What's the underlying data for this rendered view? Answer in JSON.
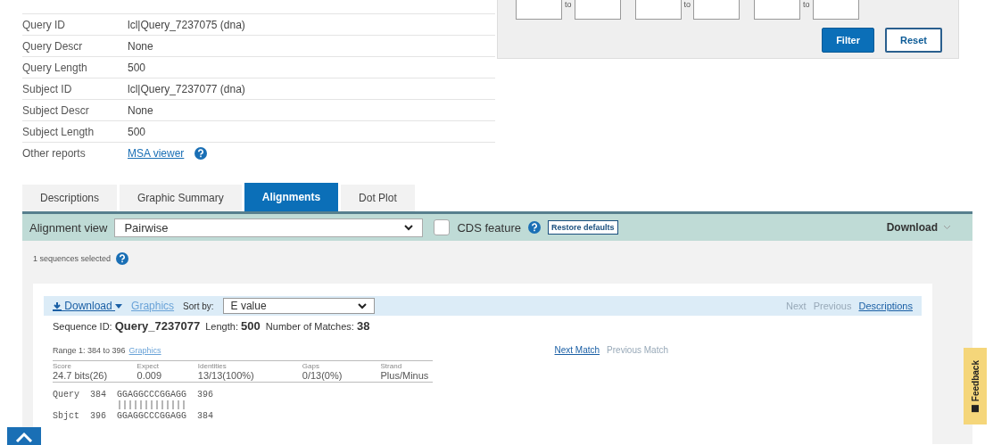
{
  "info_table": [
    {
      "label": "Query ID",
      "value": "lcl|Query_7237075 (dna)"
    },
    {
      "label": "Query Descr",
      "value": "None"
    },
    {
      "label": "Query Length",
      "value": "500"
    },
    {
      "label": "Subject ID",
      "value": "lcl|Query_7237077 (dna)"
    },
    {
      "label": "Subject Descr",
      "value": "None"
    },
    {
      "label": "Subject Length",
      "value": "500"
    },
    {
      "label": "Other reports",
      "link": "MSA viewer",
      "help": true
    }
  ],
  "filter": {
    "range_separators": [
      "to",
      "to",
      "to"
    ],
    "buttons": [
      {
        "label": "Filter",
        "kind": "primary"
      },
      {
        "label": "Reset",
        "kind": "secondary"
      }
    ]
  },
  "tabs": [
    {
      "label": "Descriptions",
      "selected": false
    },
    {
      "label": "Graphic Summary",
      "selected": false
    },
    {
      "label": "Alignments",
      "selected": true
    },
    {
      "label": "Dot Plot",
      "selected": false
    }
  ],
  "toolbar": {
    "label": "Alignment view",
    "view": "Pairwise",
    "cds_label": "CDS feature",
    "cds_checked": false,
    "restore": "Restore defaults",
    "download": "Download"
  },
  "selection_note": "1 sequences selected",
  "hit": {
    "download": "Download",
    "graphics": "Graphics",
    "sort_label": "Sort by:",
    "sort_value": "E value",
    "nav": [
      {
        "label": "Next",
        "disabled": true
      },
      {
        "label": "Previous",
        "disabled": true
      },
      {
        "label": "Descriptions",
        "disabled": false
      }
    ],
    "summary": "Sequence ID: **Query_7237077**  Length: **500**  Number of Matches: **38**",
    "range": "Range 1: 384 to 396",
    "range_graphics": "Graphics",
    "match_nav": [
      {
        "label": "Next Match",
        "disabled": false
      },
      {
        "label": "Previous Match",
        "disabled": true
      }
    ],
    "stats": [
      {
        "name": "Score",
        "value": "24.7 bits(26)"
      },
      {
        "name": "Expect",
        "value": "0.009"
      },
      {
        "name": "Identities",
        "value": "13/13(100%)"
      },
      {
        "name": "Gaps",
        "value": "0/13(0%)"
      },
      {
        "name": "Strand",
        "value": "Plus/Minus"
      }
    ],
    "alignment": [
      {
        "kind": "sequence",
        "label": "Query",
        "start": "384",
        "seq": "GGAGGCCCGGAGG",
        "end": "396"
      },
      {
        "kind": "match",
        "seq": "|||||||||||||"
      },
      {
        "kind": "sequence",
        "label": "Sbjct",
        "start": "396",
        "seq": "GGAGGCCCGGAGG",
        "end": "384"
      }
    ]
  },
  "feedback": "Feedback"
}
